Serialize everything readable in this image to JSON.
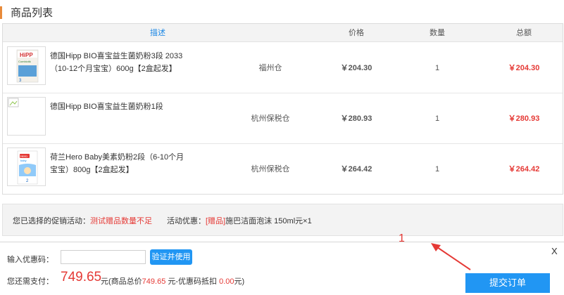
{
  "page": {
    "title": "商品列表"
  },
  "table": {
    "headers": {
      "desc": "描述",
      "price": "价格",
      "qty": "数量",
      "total": "总额"
    },
    "rows": [
      {
        "name": "德国Hipp BIO喜宝益生菌奶粉3段 2033（10-12个月宝宝）600g【2盒起发】",
        "warehouse": "福州仓",
        "price": "￥204.30",
        "qty": "1",
        "total": "￥204.30",
        "image": "hipp-combiotik-3-box"
      },
      {
        "name": "德国Hipp BIO喜宝益生菌奶粉1段",
        "warehouse": "杭州保税仓",
        "price": "￥280.93",
        "qty": "1",
        "total": "￥280.93",
        "image": "broken-image"
      },
      {
        "name": "荷兰Hero Baby美素奶粉2段（6-10个月宝宝）800g【2盒起发】",
        "warehouse": "杭州保税仓",
        "price": "￥264.42",
        "qty": "1",
        "total": "￥264.42",
        "image": "hero-baby-2-box"
      }
    ]
  },
  "promo": {
    "selected_label": "您已选择的促销活动：",
    "selected_value": "测试赠品数量不足",
    "discount_label": "活动优惠：",
    "discount_tag": "[赠品]",
    "discount_value": "施巴洁面泡沫 150ml元×1"
  },
  "checkout": {
    "coupon_label": "输入优惠码：",
    "coupon_value": "",
    "verify_button": "验证并使用",
    "pay_label": "您还需支付：",
    "pay_amount": "749.65",
    "pay_detail_prefix": "元(商品总价",
    "goods_total": "749.65",
    "pay_detail_mid": " 元-优惠码抵扣 ",
    "coupon_deduct": "0.00",
    "pay_detail_suffix": "元)",
    "close_label": "X",
    "submit_button": "提交订单"
  },
  "annotation": {
    "number": "1"
  },
  "colors": {
    "accent_orange": "#e88a3a",
    "brand_blue": "#2196f3",
    "price_red": "#e53935"
  }
}
